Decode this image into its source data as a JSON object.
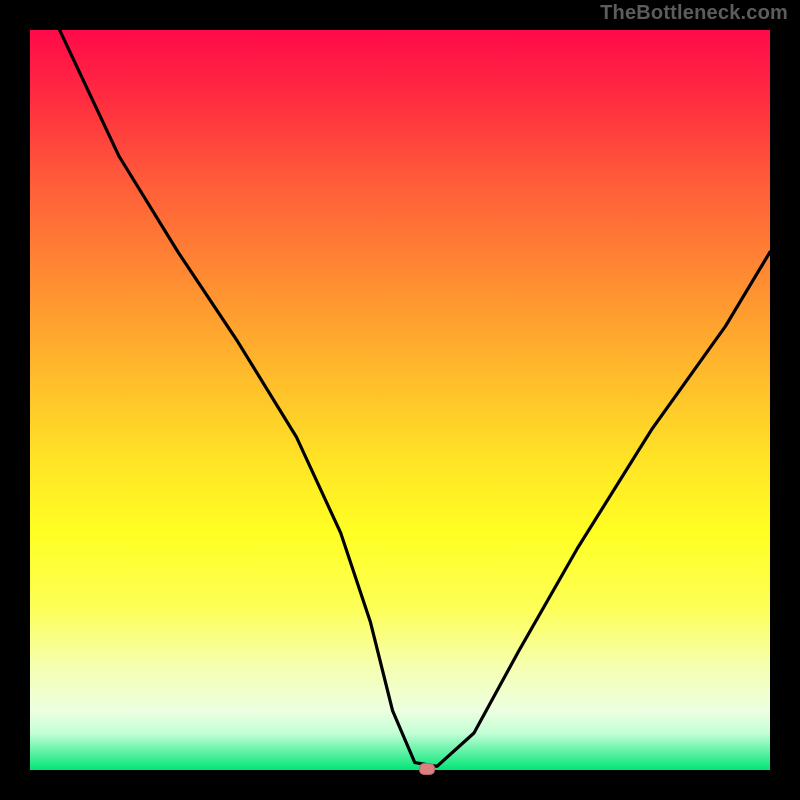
{
  "watermark": "TheBottleneck.com",
  "chart_data": {
    "type": "line",
    "title": "",
    "xlabel": "",
    "ylabel": "",
    "xlim": [
      0,
      100
    ],
    "ylim": [
      0,
      100
    ],
    "series": [
      {
        "name": "curve",
        "x": [
          4,
          12,
          20,
          28,
          36,
          42,
          46,
          49,
          52,
          55,
          60,
          66,
          74,
          84,
          94,
          100
        ],
        "y": [
          100,
          83,
          70,
          58,
          45,
          32,
          20,
          8,
          1,
          0.5,
          5,
          16,
          30,
          46,
          60,
          70
        ]
      }
    ],
    "marker": {
      "x": 53.5,
      "y": 0.3,
      "color": "#d98080"
    }
  }
}
